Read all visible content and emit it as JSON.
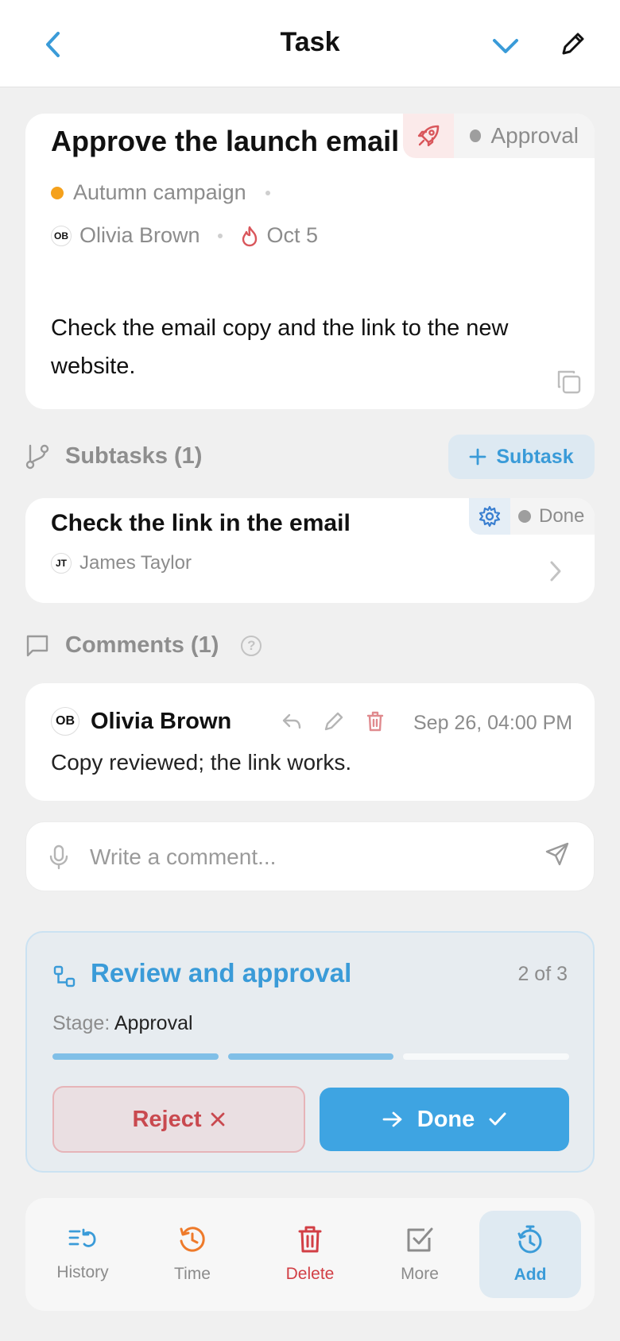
{
  "header": {
    "title": "Task"
  },
  "task": {
    "title": "Approve the launch email",
    "status": "Approval",
    "status_color": "#9e9e9e",
    "project": "Autumn campaign",
    "project_color": "#f5a11c",
    "assignee_initials": "OB",
    "assignee": "Olivia Brown",
    "due_date": "Oct 5",
    "description": "Check the email copy and the link to the new website."
  },
  "subtasks": {
    "heading": "Subtasks (1)",
    "add_label": "Subtask",
    "items": [
      {
        "title": "Check the link in the email",
        "assignee_initials": "JT",
        "assignee": "James Taylor",
        "status": "Done"
      }
    ]
  },
  "comments": {
    "heading": "Comments (1)",
    "help": "?",
    "items": [
      {
        "author_initials": "OB",
        "author": "Olivia Brown",
        "timestamp": "Sep 26, 04:00 PM",
        "text": "Copy reviewed; the link works."
      }
    ],
    "input_placeholder": "Write a comment..."
  },
  "workflow": {
    "title": "Review and approval",
    "progress_text": "2 of 3",
    "stage_label": "Stage:",
    "stage_value": "Approval",
    "steps_completed": 2,
    "steps_total": 3,
    "reject_label": "Reject",
    "done_label": "Done"
  },
  "toolbar": {
    "items": [
      {
        "label": "History",
        "icon": "history-list-icon",
        "color": "#3a9bd8"
      },
      {
        "label": "Time",
        "icon": "clock-history-icon",
        "color": "#ee7a2a"
      },
      {
        "label": "Delete",
        "icon": "trash-icon",
        "color": "#d23f45"
      },
      {
        "label": "More",
        "icon": "checkbox-icon",
        "color": "#8c8c8c"
      },
      {
        "label": "Add",
        "icon": "timer-add-icon",
        "color": "#3a9bd8"
      }
    ]
  },
  "colors": {
    "accent": "#3a9bd8",
    "danger": "#d23f45",
    "primary_button": "#3ea4e2"
  }
}
